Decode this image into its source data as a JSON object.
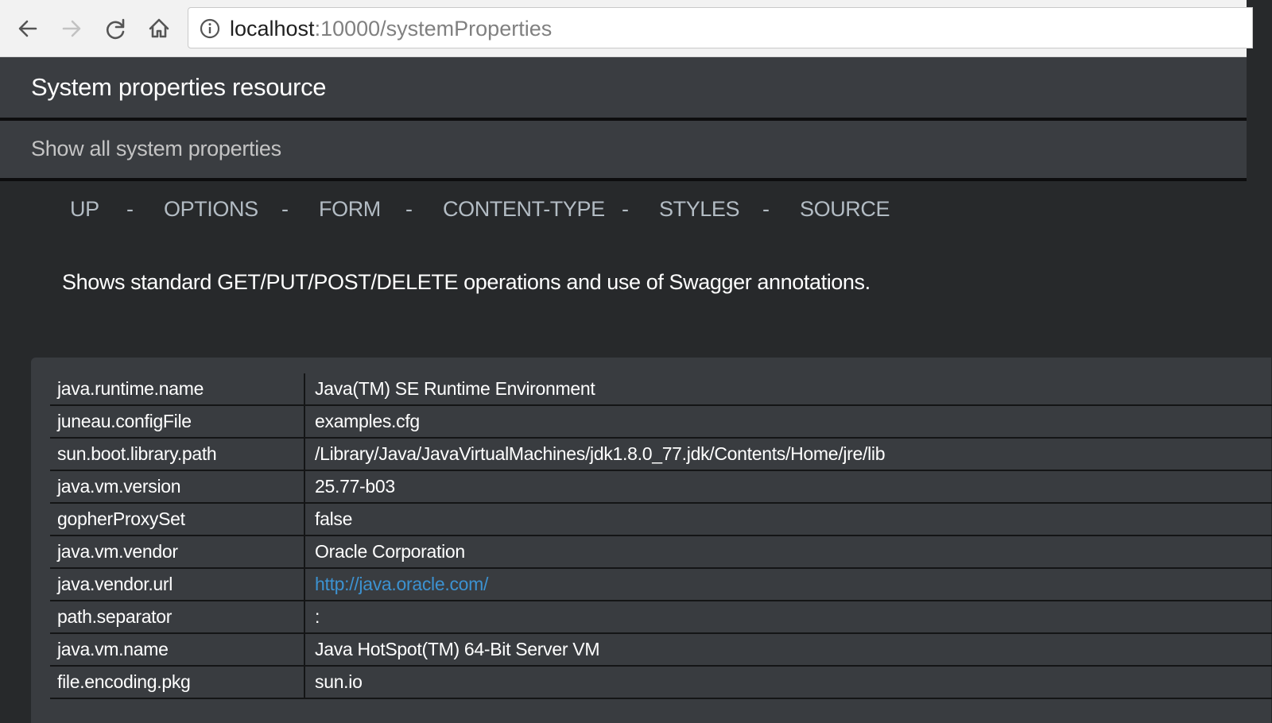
{
  "browser": {
    "url_host": "localhost",
    "url_path": ":10000/systemProperties"
  },
  "page": {
    "title": "System properties resource",
    "description": "Show all system properties",
    "intro": "Shows standard GET/PUT/POST/DELETE operations and use of Swagger annotations."
  },
  "nav": {
    "links": [
      "UP",
      "OPTIONS",
      "FORM",
      "CONTENT-TYPE",
      "STYLES",
      "SOURCE"
    ],
    "separator": "-"
  },
  "properties": [
    {
      "key": "java.runtime.name",
      "value": "Java(TM) SE Runtime Environment"
    },
    {
      "key": "juneau.configFile",
      "value": "examples.cfg"
    },
    {
      "key": "sun.boot.library.path",
      "value": "/Library/Java/JavaVirtualMachines/jdk1.8.0_77.jdk/Contents/Home/jre/lib"
    },
    {
      "key": "java.vm.version",
      "value": "25.77-b03"
    },
    {
      "key": "gopherProxySet",
      "value": "false"
    },
    {
      "key": "java.vm.vendor",
      "value": "Oracle Corporation"
    },
    {
      "key": "java.vendor.url",
      "value": "http://java.oracle.com/"
    },
    {
      "key": "path.separator",
      "value": ":"
    },
    {
      "key": "java.vm.name",
      "value": "Java HotSpot(TM) 64-Bit Server VM"
    },
    {
      "key": "file.encoding.pkg",
      "value": "sun.io"
    }
  ],
  "colors": {
    "link": "#3c92d1",
    "header_bg": "#3a3d41",
    "page_bg": "#27292b"
  }
}
